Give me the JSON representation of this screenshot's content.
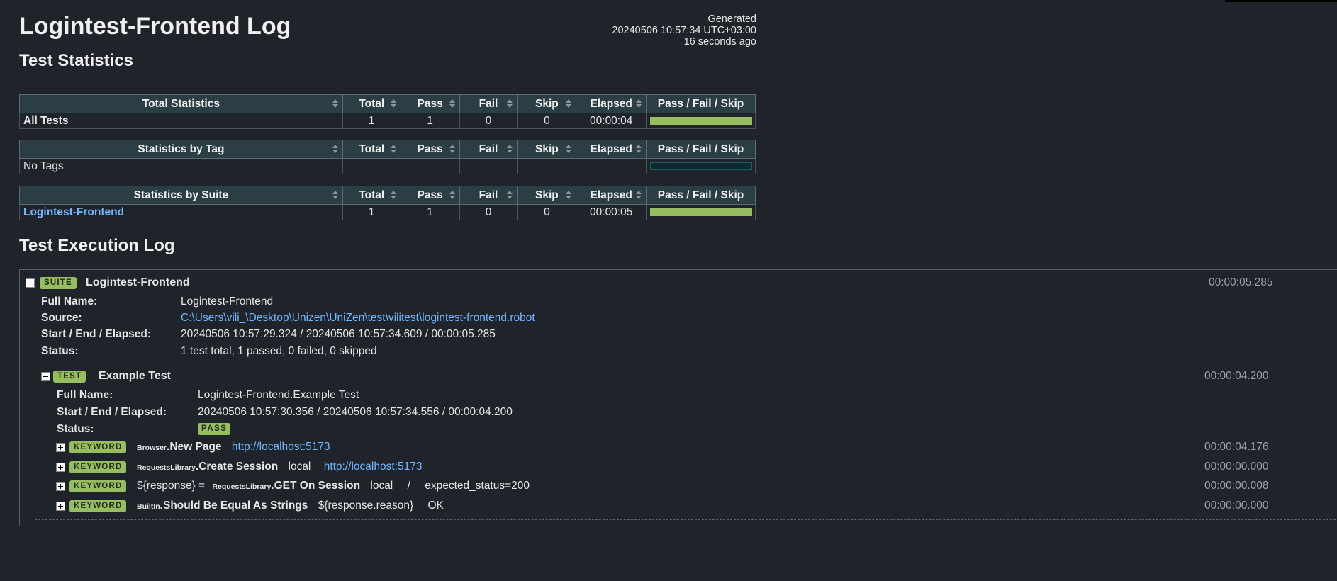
{
  "header": {
    "title": "Logintest-Frontend Log",
    "generated_label": "Generated",
    "generated_at": "20240506 10:57:34 UTC+03:00",
    "generated_ago": "16 seconds ago"
  },
  "statistics": {
    "heading": "Test Statistics",
    "columns": [
      "Total",
      "Pass",
      "Fail",
      "Skip",
      "Elapsed",
      "Pass / Fail / Skip"
    ],
    "total": {
      "title": "Total Statistics",
      "rows": [
        {
          "name": "All Tests",
          "total": "1",
          "pass": "1",
          "fail": "0",
          "skip": "0",
          "elapsed": "00:00:04",
          "pass_fraction": 1.0
        }
      ]
    },
    "tag": {
      "title": "Statistics by Tag",
      "rows": [
        {
          "name": "No Tags",
          "total": "",
          "pass": "",
          "fail": "",
          "skip": "",
          "elapsed": "",
          "pass_fraction": 0
        }
      ]
    },
    "suite": {
      "title": "Statistics by Suite",
      "rows": [
        {
          "name": "Logintest-Frontend",
          "total": "1",
          "pass": "1",
          "fail": "0",
          "skip": "0",
          "elapsed": "00:00:05",
          "pass_fraction": 1.0
        }
      ]
    }
  },
  "execution_log": {
    "heading": "Test Execution Log",
    "suite": {
      "badge": "SUITE",
      "name": "Logintest-Frontend",
      "elapsed": "00:00:05.285",
      "full_name_label": "Full Name:",
      "full_name": "Logintest-Frontend",
      "source_label": "Source:",
      "source": "C:\\Users\\vili_\\Desktop\\Unizen\\UniZen\\test\\vilitest\\logintest-frontend.robot",
      "times_label": "Start / End / Elapsed:",
      "times": "20240506 10:57:29.324 / 20240506 10:57:34.609 / 00:00:05.285",
      "status_label": "Status:",
      "status": "1 test total, 1 passed, 0 failed, 0 skipped"
    },
    "test": {
      "badge": "TEST",
      "name": "Example Test",
      "elapsed": "00:00:04.200",
      "full_name_label": "Full Name:",
      "full_name": "Logintest-Frontend.Example Test",
      "times_label": "Start / End / Elapsed:",
      "times": "20240506 10:57:30.356 / 20240506 10:57:34.556 / 00:00:04.200",
      "status_label": "Status:",
      "status": "PASS"
    },
    "keywords": [
      {
        "badge": "KEYWORD",
        "assign": "",
        "library": "Browser",
        "name": "New Page",
        "args": [
          {
            "text": "http://localhost:5173",
            "link": true
          }
        ],
        "elapsed": "00:00:04.176"
      },
      {
        "badge": "KEYWORD",
        "assign": "",
        "library": "RequestsLibrary",
        "name": "Create Session",
        "args": [
          {
            "text": "local",
            "link": false
          },
          {
            "text": "http://localhost:5173",
            "link": true
          }
        ],
        "elapsed": "00:00:00.000"
      },
      {
        "badge": "KEYWORD",
        "assign": "${response} =",
        "library": "RequestsLibrary",
        "name": "GET On Session",
        "args": [
          {
            "text": "local",
            "link": false
          },
          {
            "text": "/",
            "link": false
          },
          {
            "text": "expected_status=200",
            "link": false
          }
        ],
        "elapsed": "00:00:00.008"
      },
      {
        "badge": "KEYWORD",
        "assign": "",
        "library": "BuiltIn",
        "name": "Should Be Equal As Strings",
        "args": [
          {
            "text": "${response.reason}",
            "link": false
          },
          {
            "text": "OK",
            "link": false
          }
        ],
        "elapsed": "00:00:00.000"
      }
    ]
  },
  "colors": {
    "background": "#1f232a",
    "pass": "#97bd61",
    "link": "#73b7ff",
    "table_header": "#2b3e44"
  }
}
